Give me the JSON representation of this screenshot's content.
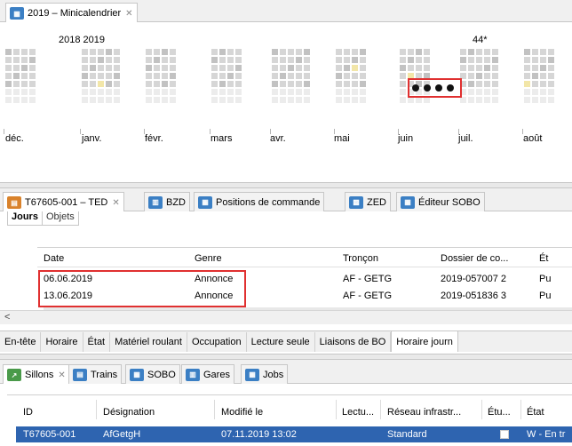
{
  "calendar": {
    "tab_label": "2019 – Minicalendrier",
    "year_label": "2018 2019",
    "week_label": "44*",
    "months": [
      "déc.",
      "janv.",
      "févr.",
      "mars",
      "avr.",
      "mai",
      "juin",
      "juil.",
      "août"
    ]
  },
  "ted": {
    "tabs": [
      {
        "label": "T67605-001 – TED"
      },
      {
        "label": "BZD"
      },
      {
        "label": "Positions de commande"
      },
      {
        "label": "ZED"
      },
      {
        "label": "Éditeur SOBO"
      }
    ],
    "inner_tabs": [
      "Jours",
      "Objets"
    ],
    "columns": [
      "Date",
      "Genre",
      "Tronçon",
      "Dossier de co...",
      "Ét"
    ],
    "rows": [
      [
        "06.06.2019",
        "Annonce",
        "AF - GETG",
        "2019-057007 2",
        "Pu"
      ],
      [
        "13.06.2019",
        "Annonce",
        "AF - GETG",
        "2019-051836 3",
        "Pu"
      ]
    ],
    "scroll_left": "<",
    "subtabs": [
      "En-tête",
      "Horaire",
      "État",
      "Matériel roulant",
      "Occupation",
      "Lecture seule",
      "Liaisons de BO",
      "Horaire journ"
    ]
  },
  "sillons": {
    "tabs": [
      {
        "label": "Sillons"
      },
      {
        "label": "Trains"
      },
      {
        "label": "SOBO"
      },
      {
        "label": "Gares"
      },
      {
        "label": "Jobs"
      }
    ],
    "columns": [
      "ID",
      "Désignation",
      "Modifié le",
      "Lectu...",
      "Réseau infrastr...",
      "Étu...",
      "État"
    ],
    "rows": [
      [
        "T67605-001",
        "AfGetgH",
        "07.11.2019 13:02",
        "",
        "Standard",
        "",
        "W - En tr"
      ]
    ]
  },
  "colors": {
    "accent": "#3b7fc4",
    "selection": "#2e64b0",
    "highlight_box": "#e03030"
  }
}
